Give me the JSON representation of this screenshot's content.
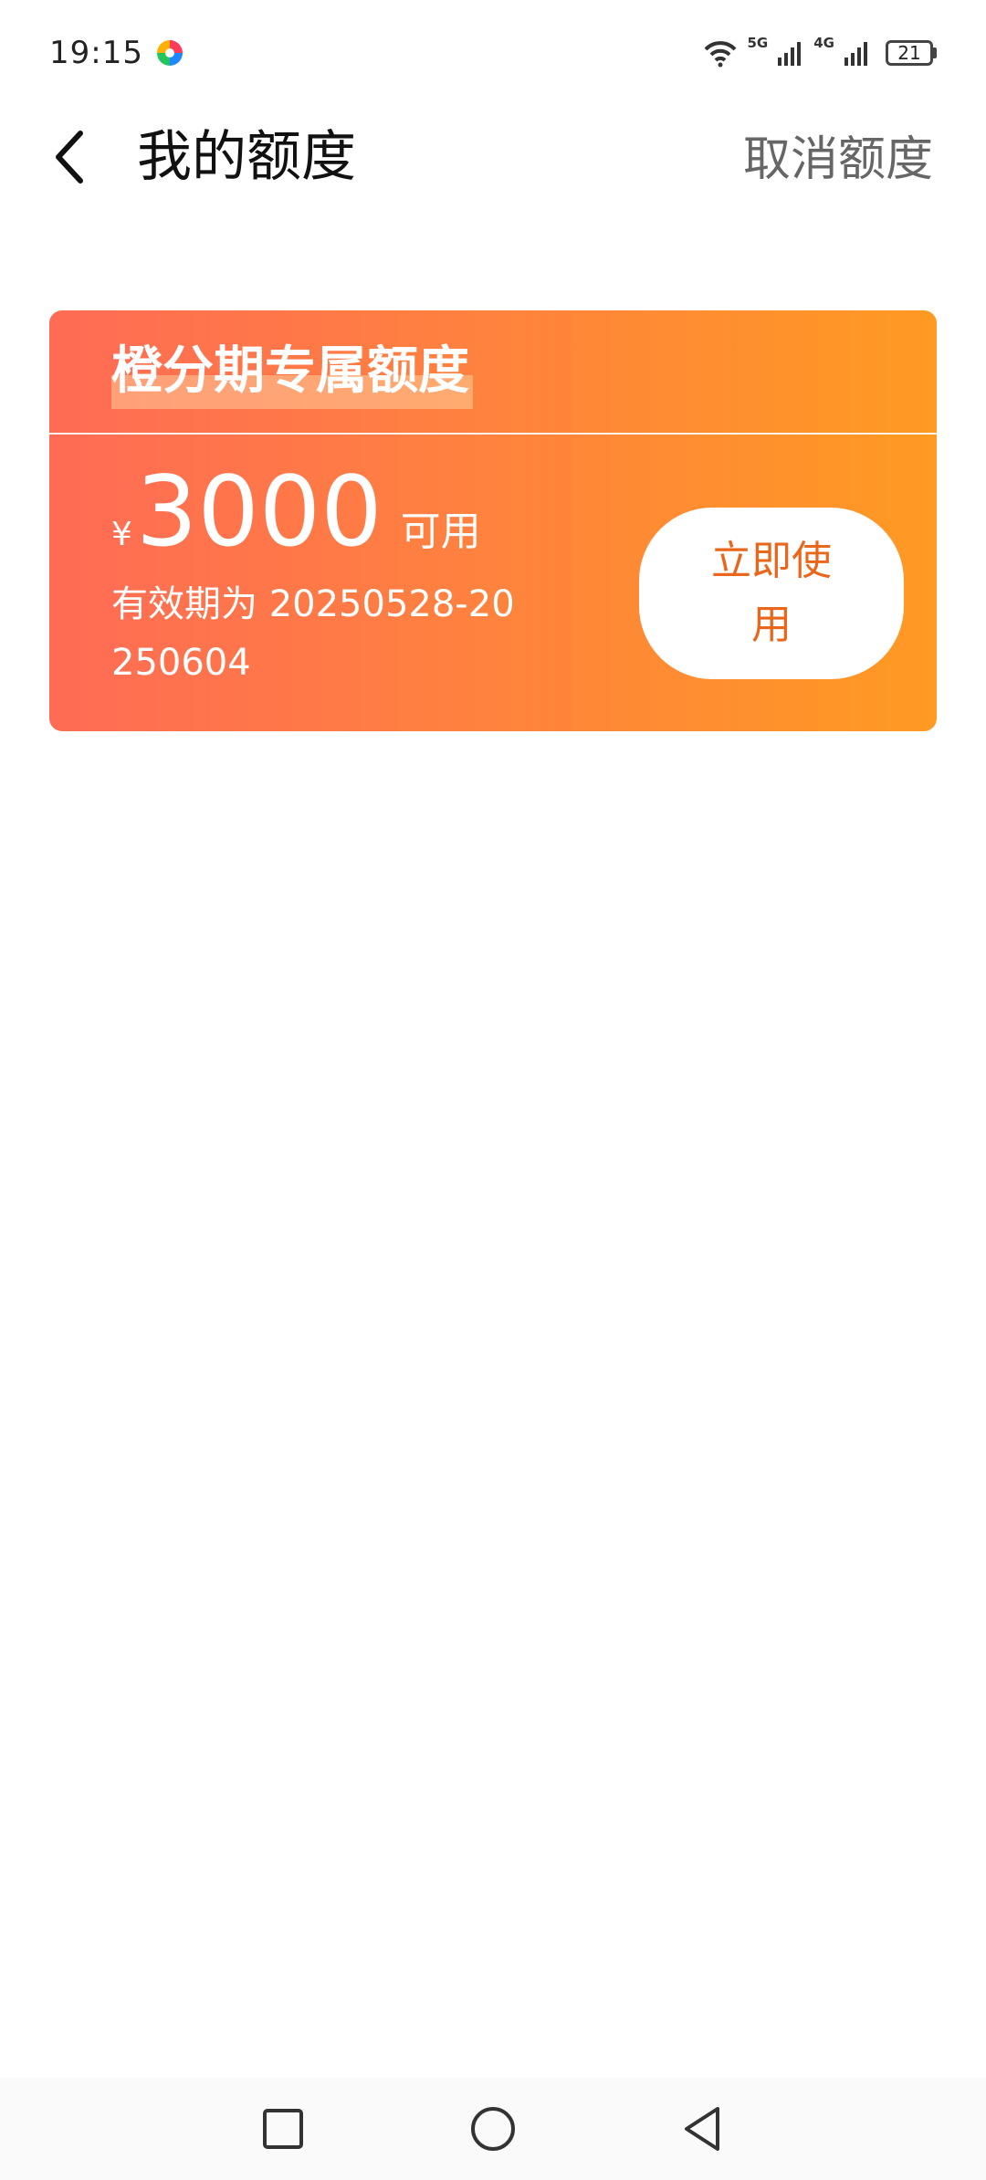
{
  "status_bar": {
    "time": "19:15",
    "app_icon": "colorful-app-logo-icon",
    "wifi_icon": "wifi-icon",
    "network_1": "5G",
    "network_2": "4G",
    "signal_icon": "signal-bars-icon",
    "battery_level": "21"
  },
  "header": {
    "back_icon": "chevron-left-icon",
    "title": "我的额度",
    "cancel_label": "取消额度"
  },
  "quota_card": {
    "title": "橙分期专属额度",
    "currency": "¥",
    "amount": "3000",
    "available_label": "可用",
    "validity_text": "有效期为 20250528-20250604",
    "use_button_label": "立即使用",
    "gradient_start": "#ff6b55",
    "gradient_end": "#ff9a22",
    "button_text_color": "#e9661a"
  },
  "nav_bar": {
    "recents_icon": "square-recents-icon",
    "home_icon": "circle-home-icon",
    "back_icon": "triangle-back-icon"
  }
}
